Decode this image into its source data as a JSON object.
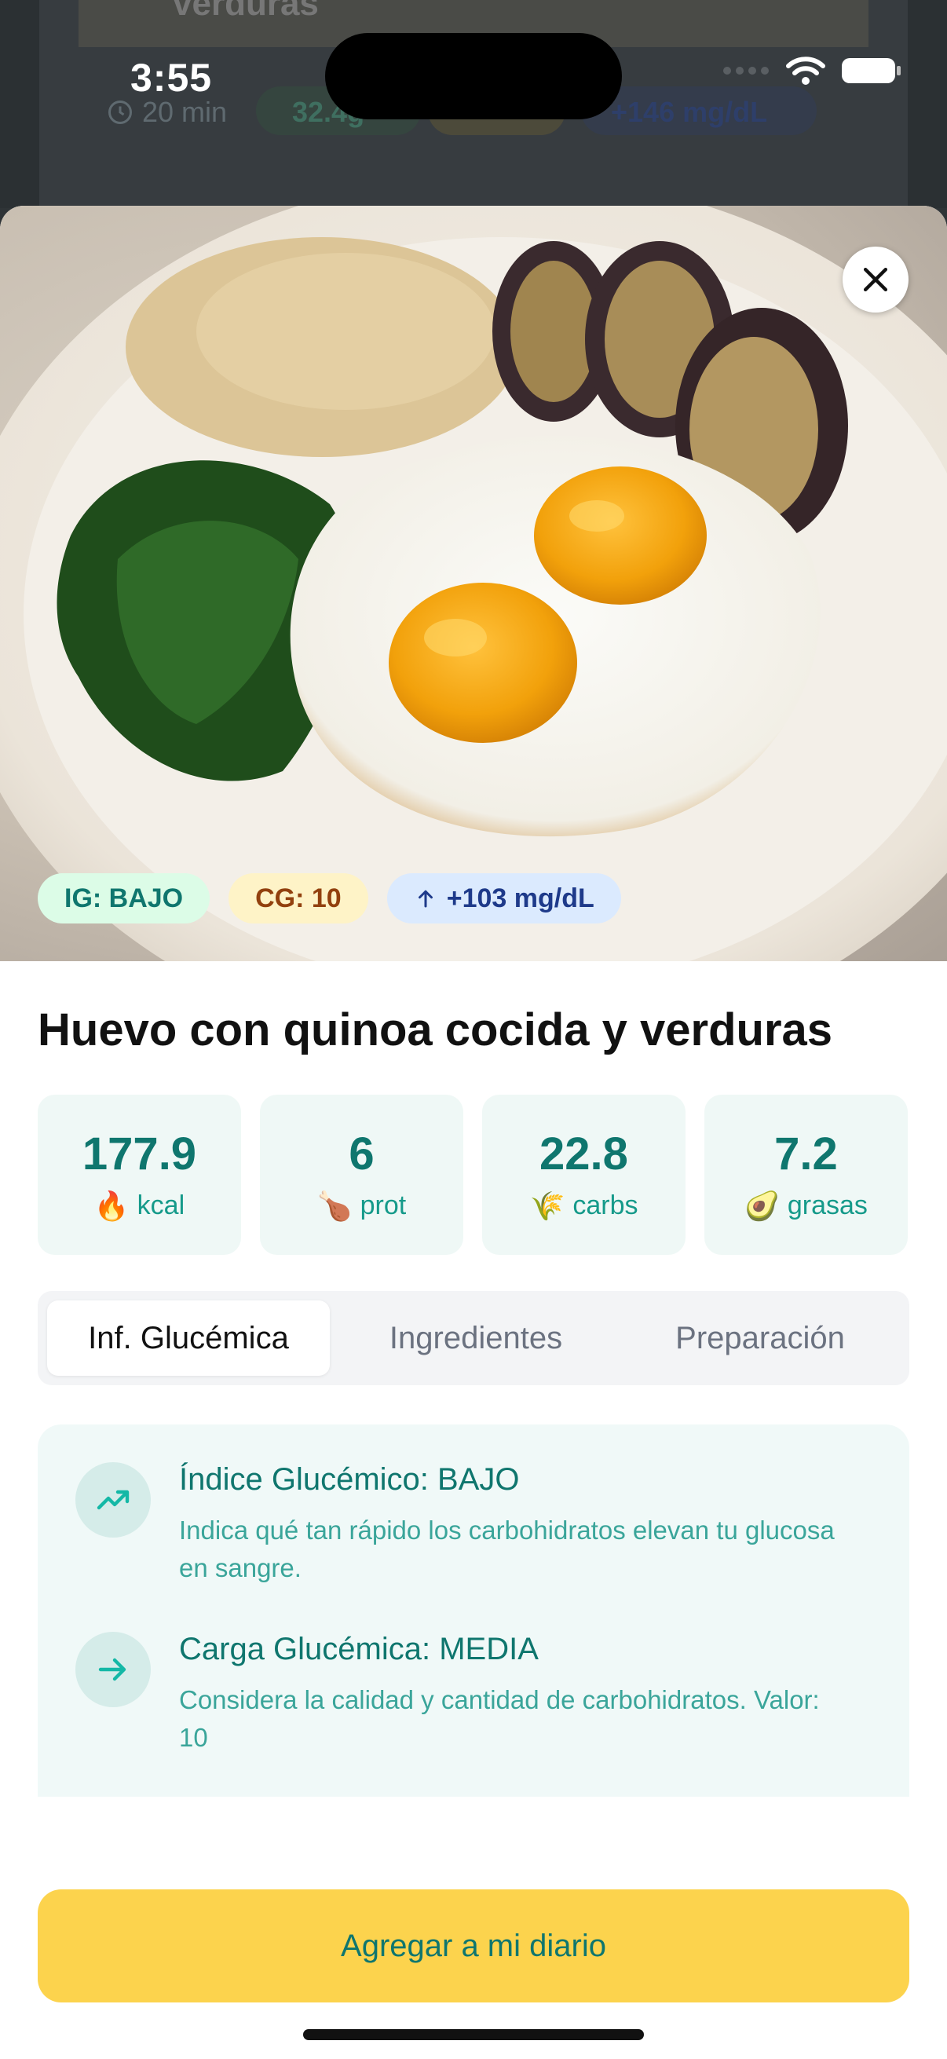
{
  "background": {
    "card_title": "verduras",
    "time": "20 min",
    "chip_1": "32.4g",
    "chip_3": "+146 mg/dL"
  },
  "status_bar": {
    "time": "3:55"
  },
  "hero": {
    "close_icon": "close-icon",
    "badges": {
      "ig": "IG: BAJO",
      "cg": "CG: 10",
      "glucose": "+103 mg/dL"
    }
  },
  "recipe": {
    "title": "Huevo con quinoa cocida y verduras",
    "macros": [
      {
        "value": "177.9",
        "emoji": "🔥",
        "label": "kcal"
      },
      {
        "value": "6",
        "emoji": "🍗",
        "label": "prot"
      },
      {
        "value": "22.8",
        "emoji": "🌾",
        "label": "carbs"
      },
      {
        "value": "7.2",
        "emoji": "🥑",
        "label": "grasas"
      }
    ]
  },
  "tabs": [
    {
      "label": "Inf. Glucémica",
      "active": true
    },
    {
      "label": "Ingredientes",
      "active": false
    },
    {
      "label": "Preparación",
      "active": false
    }
  ],
  "glycemic_info": [
    {
      "icon": "trending-up-icon",
      "title": "Índice Glucémico: BAJO",
      "desc": "Indica qué tan rápido los carbohidratos elevan tu glucosa en sangre."
    },
    {
      "icon": "arrow-right-icon",
      "title": "Carga Glucémica: MEDIA",
      "desc": "Considera la calidad y cantidad de carbohidratos. Valor: 10"
    }
  ],
  "cta_label": "Agregar a mi diario",
  "colors": {
    "accent": "#0f766e",
    "cta": "#fcd34d",
    "card_bg": "#eff8f6"
  }
}
